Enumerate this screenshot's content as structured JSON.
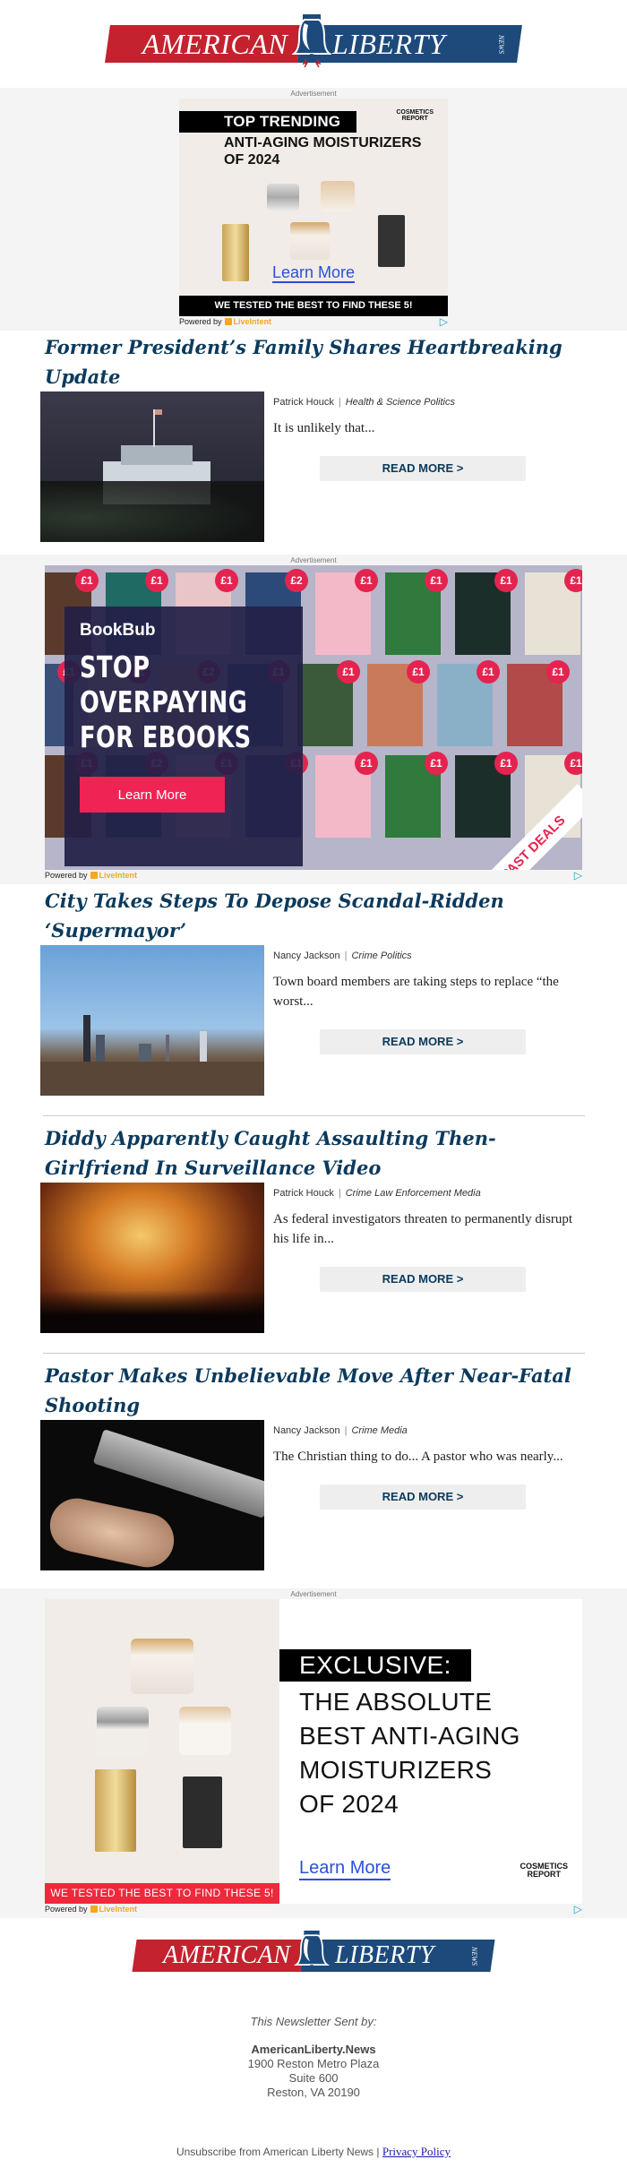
{
  "brand": {
    "left": "AMERICAN",
    "right": "LIBERTY",
    "suffix": "NEWS",
    "colors": {
      "red": "#c3222e",
      "blue": "#1d4a7b",
      "headline": "#0b3a5c"
    }
  },
  "ads": {
    "label": "Advertisement",
    "powered_by": "Powered by",
    "provider": "LiveIntent",
    "ad1": {
      "tag": "TOP TRENDING",
      "brand_line1": "COSMETICS",
      "brand_line2": "REPORT",
      "headline_line1": "ANTI-AGING MOISTURIZERS",
      "headline_line2": "OF 2024",
      "cta": "Learn More",
      "bar": "WE TESTED THE BEST TO FIND THESE 5!"
    },
    "ad2": {
      "logo": "BookBub",
      "headline_line1": "STOP",
      "headline_line2": "OVERPAYING",
      "headline_line3": "FOR EBOOKS",
      "cta": "Learn More",
      "ribbon": "PAST DEALS",
      "price": "£1",
      "price_alt": "£2"
    },
    "ad3": {
      "tag": "EXCLUSIVE:",
      "headline_line1": "THE ABSOLUTE",
      "headline_line2": "BEST ANTI-AGING",
      "headline_line3": "MOISTURIZERS",
      "headline_line4": "OF 2024",
      "cta": "Learn More",
      "brand_line1": "COSMETICS",
      "brand_line2": "REPORT",
      "bar": "WE TESTED THE BEST TO FIND THESE 5!"
    }
  },
  "articles": [
    {
      "title": "Former President’s Family Shares Heartbreaking Update",
      "author": "Patrick Houck",
      "categories": "Health & Science Politics",
      "excerpt": "It is unlikely that...",
      "cta": "READ MORE >",
      "image": "white-house-night"
    },
    {
      "title": "City Takes Steps To Depose Scandal-Ridden ‘Supermayor’",
      "author": "Nancy Jackson",
      "categories": "Crime Politics",
      "excerpt": "Town board members are taking steps to replace “the worst...",
      "cta": "READ MORE >",
      "image": "city-skyline"
    },
    {
      "title": "Diddy Apparently Caught Assaulting Then-Girlfriend In Surveillance Video",
      "author": "Patrick Houck",
      "categories": "Crime Law Enforcement Media",
      "excerpt": "As federal investigators threaten to permanently disrupt his life in...",
      "cta": "READ MORE >",
      "image": "concert-crowd"
    },
    {
      "title": "Pastor Makes Unbelievable Move After Near-Fatal Shooting",
      "author": "Nancy Jackson",
      "categories": "Crime Media",
      "excerpt": "The Christian thing to do... A pastor who was nearly...",
      "cta": "READ MORE >",
      "image": "handgun"
    }
  ],
  "footer": {
    "sent_by": "This Newsletter Sent by:",
    "org": "AmericanLiberty.News",
    "address_line1": "1900 Reston Metro Plaza",
    "address_line2": "Suite 600",
    "address_line3": "Reston, VA 20190",
    "unsubscribe": "Unsubscribe from American Liberty News",
    "separator": "|",
    "privacy": "Privacy Policy"
  }
}
